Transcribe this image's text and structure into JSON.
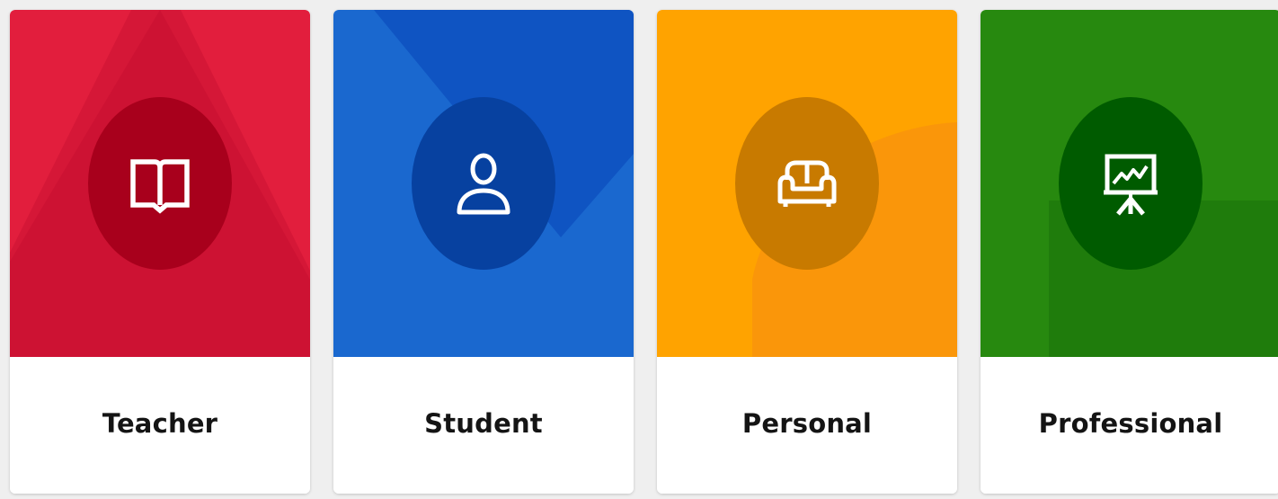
{
  "cards": [
    {
      "label": "Teacher",
      "icon": "book-icon",
      "colors": {
        "base": "#e21e3d",
        "shade": "#cd1233",
        "badge": "#a8001c"
      }
    },
    {
      "label": "Student",
      "icon": "user-icon",
      "colors": {
        "base": "#1a68cf",
        "shade": "#0f54c2",
        "badge": "#0741a0"
      }
    },
    {
      "label": "Personal",
      "icon": "sofa-icon",
      "colors": {
        "base": "#ffa300",
        "shade": "#fa960a",
        "badge": "#c87a00"
      }
    },
    {
      "label": "Professional",
      "icon": "presentation-chart-icon",
      "colors": {
        "base": "#27890f",
        "shade": "#1f7c0c",
        "badge": "#005b00"
      }
    }
  ]
}
